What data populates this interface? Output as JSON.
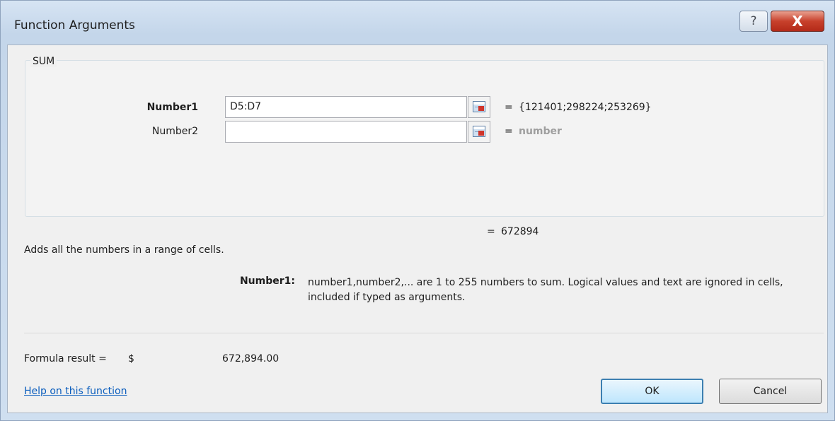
{
  "window": {
    "title": "Function Arguments"
  },
  "titlebar": {
    "help_glyph": "?",
    "close_glyph": "X"
  },
  "function": {
    "name": "SUM",
    "args": [
      {
        "label": "Number1",
        "value": "D5:D7",
        "result": "{121401;298224;253269}"
      },
      {
        "label": "Number2",
        "value": "",
        "result": "number"
      }
    ],
    "equals": "=",
    "total": "672894",
    "description": "Adds all the numbers in a range of cells.",
    "arg_help_label": "Number1:",
    "arg_help_text": "number1,number2,... are 1 to 255 numbers to sum. Logical values and text are ignored in cells, included if typed as arguments."
  },
  "formula_result": {
    "label": "Formula result =",
    "currency": "$",
    "value": "672,894.00"
  },
  "footer": {
    "help_link": "Help on this function",
    "ok": "OK",
    "cancel": "Cancel"
  },
  "icons": {
    "collapse": "collapse-dialog-icon",
    "help": "help-icon",
    "close": "close-icon"
  },
  "colors": {
    "link": "#0a5dbd",
    "close_button": "#c8412c",
    "placeholder": "#9e9e9e"
  }
}
